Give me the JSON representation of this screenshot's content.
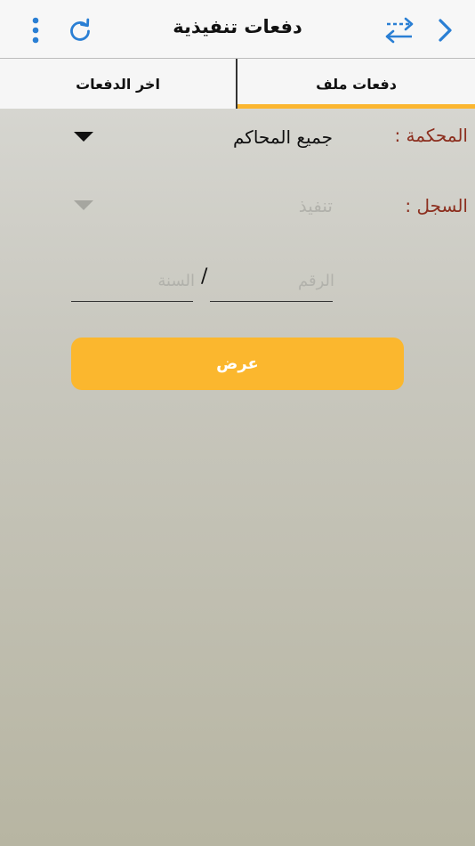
{
  "navbar": {
    "title": "دفعات تنفيذية",
    "icons": {
      "menu": "more-vertical-icon",
      "refresh": "refresh-icon",
      "transfer": "swap-arrows-icon",
      "next": "chevron-right-icon"
    },
    "accent_color": "#2a7fd4"
  },
  "tabs": [
    {
      "label": "اخر الدفعات",
      "active": false
    },
    {
      "label": "دفعات ملف",
      "active": true
    }
  ],
  "form": {
    "court_label": "المحكمة :",
    "court_value": "جميع المحاكم",
    "register_label": "السجل :",
    "register_value": "تنفيذ",
    "number_placeholder": "الرقم",
    "year_placeholder": "السنة",
    "separator": "/",
    "submit_label": "عرض"
  },
  "colors": {
    "accent": "#fbb62f",
    "label": "#8c2f1f"
  }
}
